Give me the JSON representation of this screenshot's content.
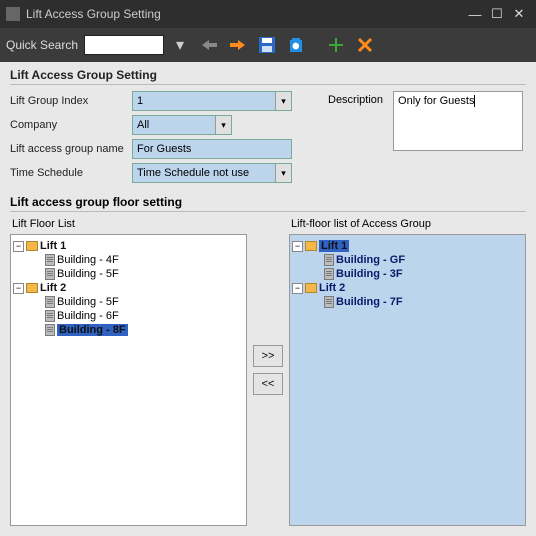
{
  "window": {
    "title": "Lift Access Group Setting"
  },
  "toolbar": {
    "quicksearch_label": "Quick Search",
    "quicksearch_value": ""
  },
  "section1": {
    "header": "Lift Access Group Setting",
    "lift_group_index_label": "Lift Group Index",
    "lift_group_index_value": "1",
    "company_label": "Company",
    "company_value": "All",
    "group_name_label": "Lift access group name",
    "group_name_value": "For Guests",
    "time_schedule_label": "Time Schedule",
    "time_schedule_value": "Time Schedule not use",
    "description_label": "Description",
    "description_value": "Only for Guests"
  },
  "section2": {
    "header": "Lift access group floor setting",
    "left_header": "Lift  Floor List",
    "right_header": "Lift-floor list of Access Group",
    "move_right": ">>",
    "move_left": "<<"
  },
  "left_tree": {
    "lift1": "Lift 1",
    "lift1_items": [
      "Building - 4F",
      "Building - 5F"
    ],
    "lift2": "Lift 2",
    "lift2_items": [
      "Building - 5F",
      "Building - 6F",
      "Building - 8F"
    ]
  },
  "right_tree": {
    "lift1": "Lift 1",
    "lift1_items": [
      "Building - GF",
      "Building - 3F"
    ],
    "lift2": "Lift 2",
    "lift2_items": [
      "Building - 7F"
    ]
  }
}
